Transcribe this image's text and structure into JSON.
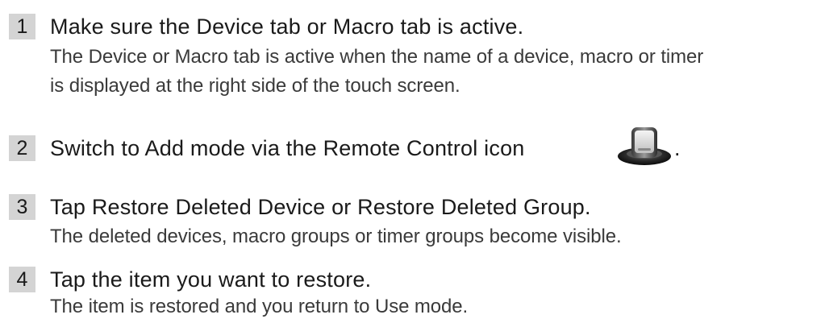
{
  "steps": [
    {
      "number": "1",
      "title": "Make sure the Device tab or Macro tab is active.",
      "description": [
        "The Device or Macro tab is active when the name of a device, macro or timer",
        "is displayed at the right side of the touch screen."
      ]
    },
    {
      "number": "2",
      "title": "Switch to Add mode via the Remote Control icon",
      "title_suffix": ".",
      "icon": "remote-control-icon"
    },
    {
      "number": "3",
      "title": "Tap Restore Deleted Device or Restore Deleted Group.",
      "description": [
        "The deleted devices, macro groups or timer groups become visible."
      ]
    },
    {
      "number": "4",
      "title": "Tap the item you want to restore.",
      "description": [
        "The item is restored and you return to Use mode."
      ]
    }
  ],
  "colors": {
    "number_badge_bg": "#d4d4d4",
    "title_text": "#1a1a1a",
    "description_text": "#3a3a3a"
  }
}
